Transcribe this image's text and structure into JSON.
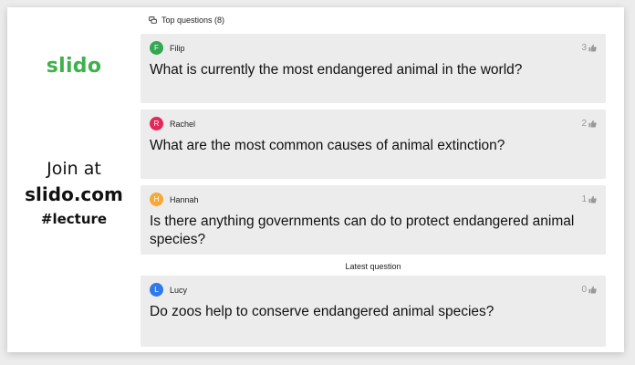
{
  "branding": {
    "logo": "slido",
    "join_at": "Join at",
    "join_url": "slido.com",
    "event_code": "#lecture"
  },
  "header": {
    "icon": "chat-bubbles-icon",
    "title": "Top questions (8)"
  },
  "questions": [
    {
      "initial": "F",
      "author": "Filip",
      "avatar_color": "#33a852",
      "likes": "3",
      "text": "What is currently the most endangered animal in the world?"
    },
    {
      "initial": "R",
      "author": "Rachel",
      "avatar_color": "#e5265a",
      "likes": "2",
      "text": "What are the most common causes of animal extinction?"
    },
    {
      "initial": "H",
      "author": "Hannah",
      "avatar_color": "#f7a933",
      "likes": "1",
      "text": "Is there anything governments can do to protect endangered animal species?"
    }
  ],
  "latest_label": "Latest question",
  "latest": {
    "initial": "L",
    "author": "Lucy",
    "avatar_color": "#2f79e8",
    "likes": "0",
    "text": "Do zoos help to conserve endangered animal species?"
  },
  "colors": {
    "brand": "#3db24a",
    "card_bg": "#ececec",
    "likes": "#999999"
  }
}
